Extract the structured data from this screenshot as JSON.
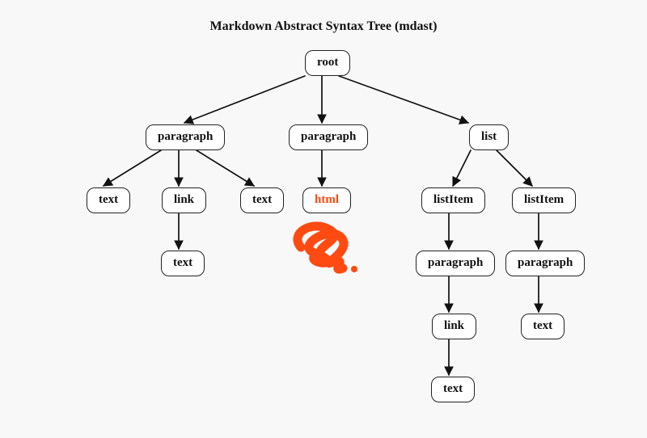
{
  "title": "Markdown Abstract Syntax Tree (mdast)",
  "nodes": {
    "root": "root",
    "para1": "paragraph",
    "para2": "paragraph",
    "list": "list",
    "text1": "text",
    "link1": "link",
    "text2": "text",
    "html": "html",
    "text_link": "text",
    "listItem1": "listItem",
    "listItem2": "listItem",
    "li1_para": "paragraph",
    "li2_para": "paragraph",
    "li1_link": "link",
    "li2_text": "text",
    "li1_text": "text"
  },
  "accent_color": "#ff4a11"
}
